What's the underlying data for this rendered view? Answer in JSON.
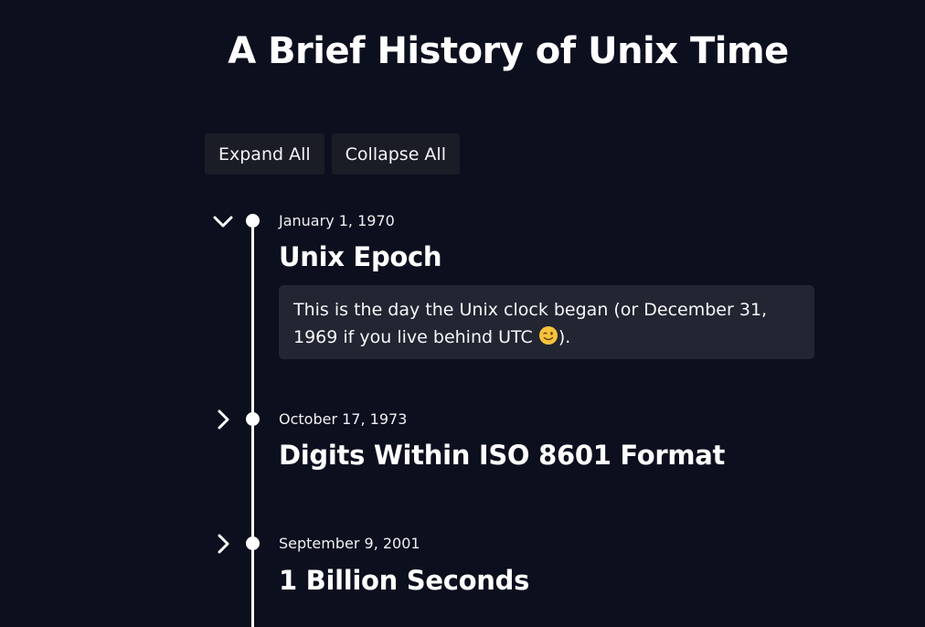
{
  "page": {
    "title": "A Brief History of Unix Time"
  },
  "controls": {
    "expand_all_label": "Expand All",
    "collapse_all_label": "Collapse All"
  },
  "timeline": {
    "items": [
      {
        "date": "January 1, 1970",
        "title": "Unix Epoch",
        "expanded": true,
        "description_before_emoji": "This is the day the Unix clock began (or December 31, 1969 if you live behind UTC",
        "description_emoji": "winking-face",
        "description_after_emoji": ")."
      },
      {
        "date": "October 17, 1973",
        "title": "Digits Within ISO 8601 Format",
        "expanded": false
      },
      {
        "date": "September 9, 2001",
        "title": "1 Billion Seconds",
        "expanded": false
      }
    ]
  },
  "colors": {
    "background": "#0c0f1e",
    "button_background": "#1a1c26",
    "description_background": "#222532",
    "text": "#ffffff"
  }
}
